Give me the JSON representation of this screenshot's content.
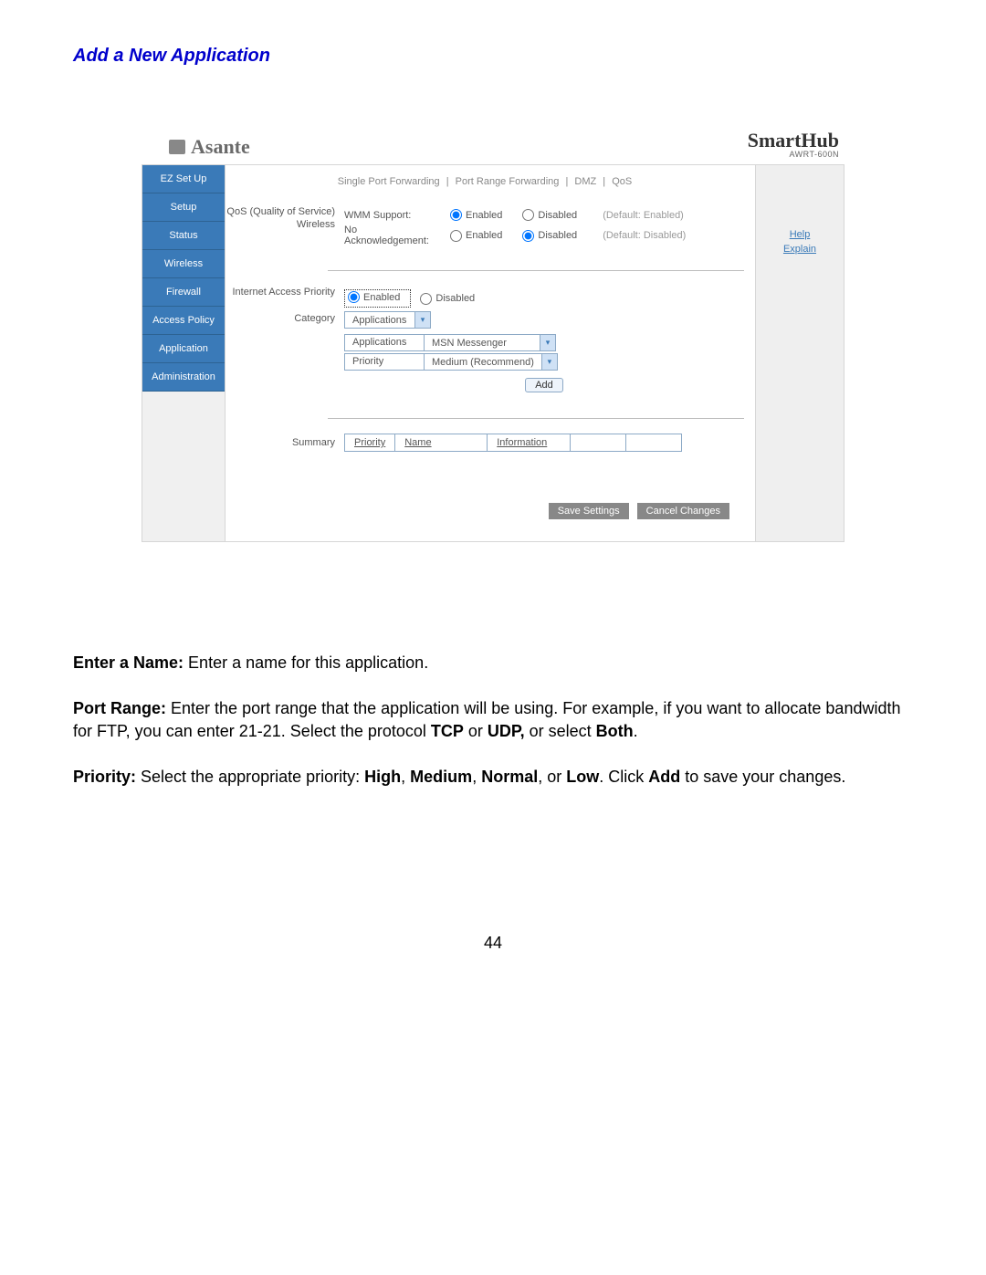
{
  "doc": {
    "title": "Add a New Application",
    "page_number": "44",
    "paragraphs": {
      "p1_bold": "Enter a Name:",
      "p1_rest": " Enter a name for this application.",
      "p2_bold": "Port Range:",
      "p2_rest_a": " Enter the port range that the application will be using. For example, if you want to allocate bandwidth for FTP, you can enter 21-21. Select the protocol ",
      "p2_bold2": "TCP",
      "p2_rest_b": " or ",
      "p2_bold3": "UDP,",
      "p2_rest_c": " or select ",
      "p2_bold4": "Both",
      "p2_rest_d": ".",
      "p3_bold": "Priority:",
      "p3_rest_a": " Select the appropriate priority: ",
      "p3_bold2": "High",
      "p3_c1": ", ",
      "p3_bold3": "Medium",
      "p3_c2": ", ",
      "p3_bold4": "Normal",
      "p3_c3": ", or ",
      "p3_bold5": "Low",
      "p3_rest_b": ". Click ",
      "p3_bold6": "Add",
      "p3_rest_c": " to save your changes."
    }
  },
  "router": {
    "brand": "Asante",
    "hub_title": "SmartHub",
    "hub_model": "AWRT-600N",
    "sidebar": {
      "items": [
        {
          "label": "EZ Set Up"
        },
        {
          "label": "Setup"
        },
        {
          "label": "Status"
        },
        {
          "label": "Wireless"
        },
        {
          "label": "Firewall"
        },
        {
          "label": "Access Policy"
        },
        {
          "label": "Application"
        },
        {
          "label": "Administration"
        }
      ]
    },
    "tabs": {
      "t1": "Single Port Forwarding",
      "t2": "Port Range Forwarding",
      "t3": "DMZ",
      "t4": "QoS"
    },
    "qos": {
      "section_label": "QoS (Quality of Service)",
      "wireless_label": "Wireless",
      "wmm_label": "WMM Support:",
      "noack_label": "No Acknowledgement:",
      "enabled": "Enabled",
      "disabled": "Disabled",
      "default_enabled": "(Default: Enabled)",
      "default_disabled": "(Default: Disabled)"
    },
    "iap": {
      "section_label": "Internet Access Priority",
      "category_label": "Category",
      "category_value": "Applications",
      "row_app_label": "Applications",
      "row_app_value": "MSN Messenger",
      "row_priority_label": "Priority",
      "row_priority_value": "Medium (Recommend)",
      "add_label": "Add"
    },
    "summary": {
      "label": "Summary",
      "cols": {
        "c1": "Priority",
        "c2": "Name",
        "c3": "Information"
      }
    },
    "buttons": {
      "save": "Save Settings",
      "cancel": "Cancel Changes"
    },
    "help": {
      "help": "Help",
      "explain": "Explain"
    }
  }
}
